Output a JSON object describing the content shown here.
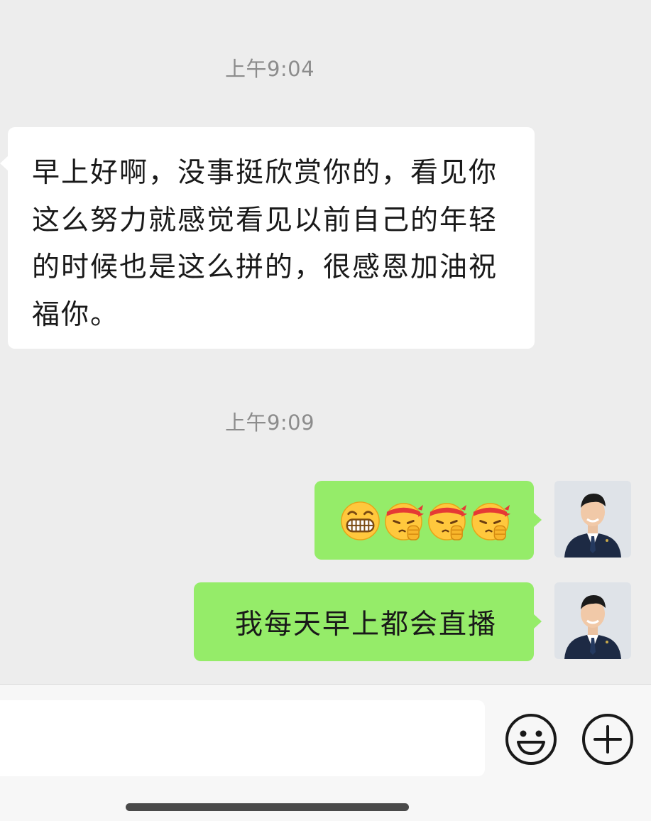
{
  "messages": {
    "time_1": "上午9:04",
    "incoming_text": "早上好啊，没事挺欣赏你的，看见你这么努力就感觉看见以前自己的年轻的时候也是这么拼的，很感恩加油祝福你。",
    "time_2": "上午9:09",
    "outgoing_emoji_names": [
      "grinning-face-icon",
      "determined-face-icon",
      "determined-face-icon",
      "determined-face-icon"
    ],
    "outgoing_text": "我每天早上都会直播"
  },
  "colors": {
    "background": "#ededed",
    "incoming_bubble": "#ffffff",
    "outgoing_bubble": "#95ec69",
    "timestamp": "#8c8c8c"
  }
}
